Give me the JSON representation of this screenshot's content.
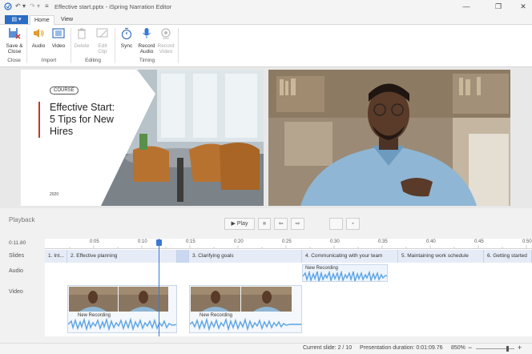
{
  "window": {
    "title": "Effective start.pptx - iSpring Narration Editor"
  },
  "tabs": {
    "file": "",
    "home": "Home",
    "view": "View"
  },
  "ribbon": {
    "save_close": [
      "Save &",
      "Close"
    ],
    "audio": "Audio",
    "video": "Video",
    "delete": "Delete",
    "edit_clip": [
      "Edit",
      "Clip"
    ],
    "sync": "Sync",
    "record_audio": [
      "Record",
      "Audio"
    ],
    "record_video": [
      "Record",
      "Video"
    ],
    "groups": {
      "close": "Close",
      "import": "Import",
      "editing": "Editing",
      "timing": "Timing"
    }
  },
  "slide": {
    "badge": "COURSE",
    "title_line1": "Effective Start:",
    "title_line2": "5 Tips for New",
    "title_line3": "Hires",
    "year": "2020"
  },
  "playback": {
    "title": "Playback",
    "play": "Play",
    "time": "0:11.80",
    "ticks": [
      "0:05",
      "0:10",
      "0:15",
      "0:20",
      "0:25",
      "0:30",
      "0:35",
      "0:40",
      "0:45",
      "0:50"
    ],
    "row_labels": {
      "slides": "Slides",
      "audio": "Audio",
      "video": "Video"
    },
    "slides": [
      "1. Int...",
      "2. Effective planning",
      "3. Clarifying goals",
      "4. Communicating with your team",
      "5. Maintaining work schedule",
      "6. Getting started"
    ],
    "audio_clip": "New Recording",
    "video_clip_1": "New Recording",
    "video_clip_2": "New Recording"
  },
  "status": {
    "current_slide": "Current slide: 2 / 10",
    "duration": "Presentation duration: 0:01:09.76",
    "zoom": "850%"
  },
  "colors": {
    "accent": "#2b6cc4",
    "slide_bg": "#e6ecf7",
    "wave": "#5aa3e6"
  }
}
